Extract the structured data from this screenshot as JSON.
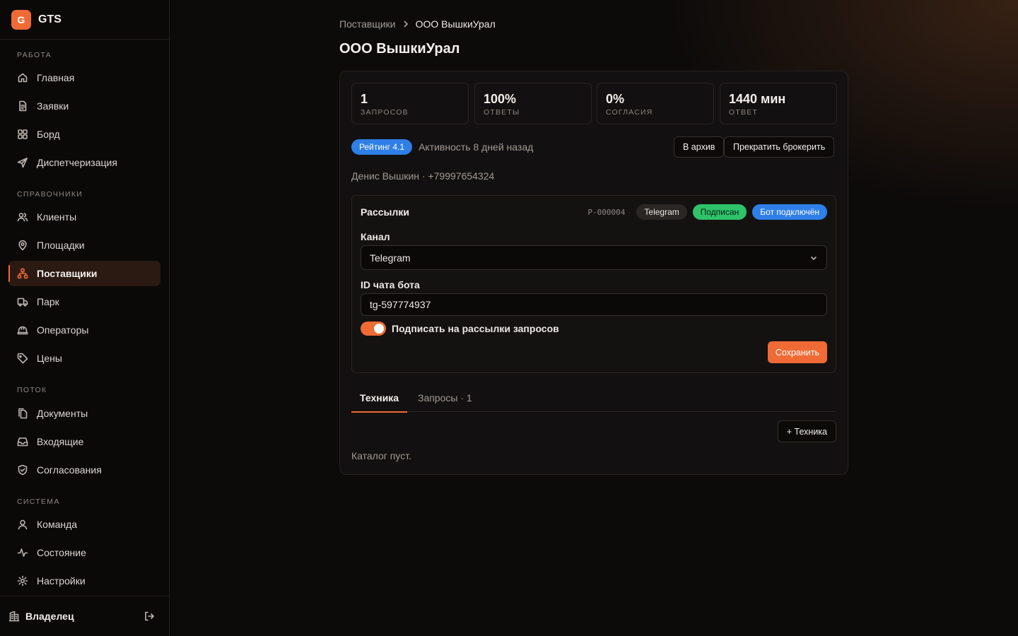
{
  "app": {
    "logo_letter": "G",
    "name": "GTS",
    "accent": "#f06a35"
  },
  "sidebar": {
    "sections": [
      {
        "title": "Работа",
        "items": [
          {
            "label": "Главная",
            "icon": "home-icon"
          },
          {
            "label": "Заявки",
            "icon": "document-icon"
          },
          {
            "label": "Борд",
            "icon": "grid-icon"
          },
          {
            "label": "Диспетчеризация",
            "icon": "send-icon"
          }
        ]
      },
      {
        "title": "Справочники",
        "items": [
          {
            "label": "Клиенты",
            "icon": "users-icon"
          },
          {
            "label": "Площадки",
            "icon": "map-pin-icon"
          },
          {
            "label": "Поставщики",
            "icon": "network-icon",
            "active": true
          },
          {
            "label": "Парк",
            "icon": "truck-icon"
          },
          {
            "label": "Операторы",
            "icon": "hard-hat-icon"
          },
          {
            "label": "Цены",
            "icon": "tag-icon"
          }
        ]
      },
      {
        "title": "Поток",
        "items": [
          {
            "label": "Документы",
            "icon": "files-icon"
          },
          {
            "label": "Входящие",
            "icon": "inbox-icon"
          },
          {
            "label": "Согласования",
            "icon": "shield-check-icon"
          }
        ]
      },
      {
        "title": "Система",
        "items": [
          {
            "label": "Команда",
            "icon": "user-icon"
          },
          {
            "label": "Состояние",
            "icon": "activity-icon"
          },
          {
            "label": "Настройки",
            "icon": "gear-icon"
          }
        ]
      }
    ],
    "footer": {
      "user_label": "Владелец"
    }
  },
  "breadcrumb": {
    "parent": "Поставщики",
    "current": "ООО ВышкиУрал"
  },
  "page": {
    "title": "ООО ВышкиУрал"
  },
  "stats": [
    {
      "value": "1",
      "label": "запросов"
    },
    {
      "value": "100%",
      "label": "ответы"
    },
    {
      "value": "0%",
      "label": "согласия"
    },
    {
      "value": "1440 мин",
      "label": "ответ"
    }
  ],
  "rating": {
    "badge": "Рейтинг 4.1",
    "activity": "Активность 8 дней назад"
  },
  "actions": {
    "archive": "В архив",
    "stop_brokering": "Прекратить брокерить"
  },
  "contact": "Денис Вышкин · +79997654324",
  "mailing": {
    "title": "Рассылки",
    "id": "P-000004",
    "channel_badge": "Telegram",
    "status_badge": "Подписан",
    "bot_badge": "Бот подключён",
    "channel_label": "Канал",
    "channel_value": "Telegram",
    "chat_id_label": "ID чата бота",
    "chat_id_value": "tg-597774937",
    "subscribe_label": "Подписать на рассылки запросов",
    "subscribe_on": true,
    "save_label": "Сохранить"
  },
  "tabs": [
    {
      "label": "Техника",
      "active": true
    },
    {
      "label": "Запросы · 1",
      "active": false
    }
  ],
  "catalog": {
    "add_label": "+ Техника",
    "empty_text": "Каталог пуст."
  }
}
